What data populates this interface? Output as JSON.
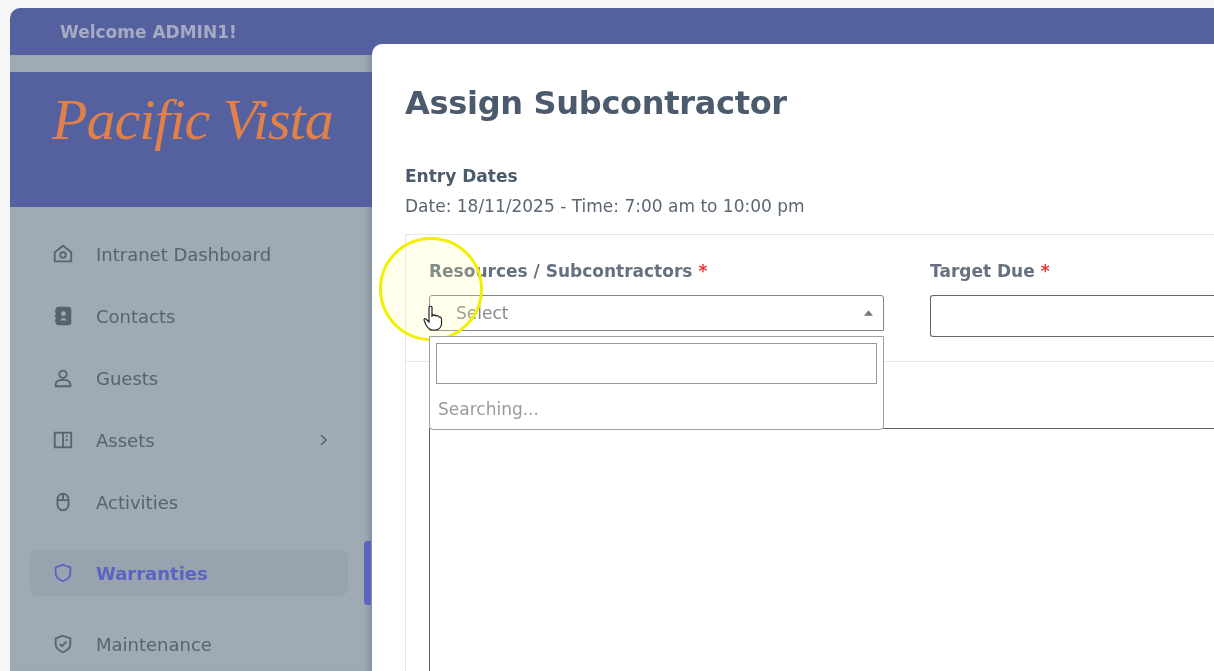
{
  "header": {
    "welcome": "Welcome ADMIN1!"
  },
  "logo": {
    "text": "Pacific Vista"
  },
  "sidebar": {
    "items": [
      {
        "label": "Intranet Dashboard",
        "kind": "house",
        "selected": false,
        "has_children": false
      },
      {
        "label": "Contacts",
        "kind": "contactbook",
        "selected": false,
        "has_children": false
      },
      {
        "label": "Guests",
        "kind": "person",
        "selected": false,
        "has_children": false
      },
      {
        "label": "Assets",
        "kind": "panel",
        "selected": false,
        "has_children": true
      },
      {
        "label": "Activities",
        "kind": "mouse",
        "selected": false,
        "has_children": false
      },
      {
        "label": "Warranties",
        "kind": "shield",
        "selected": true,
        "has_children": false
      },
      {
        "label": "Maintenance",
        "kind": "shieldcheck",
        "selected": false,
        "has_children": false
      }
    ]
  },
  "modal": {
    "title": "Assign Subcontractor",
    "section_title": "Entry Dates",
    "section_text": "Date: 18/11/2025 - Time: 7:00 am to 10:00 pm",
    "fields": [
      {
        "kind": "select",
        "label": "Resources / Subcontractors",
        "required_mark": "*",
        "placeholder": "Select",
        "expanded": true,
        "status": "Searching..."
      },
      {
        "kind": "text",
        "label": "Target Due",
        "required_mark": "*"
      }
    ]
  }
}
